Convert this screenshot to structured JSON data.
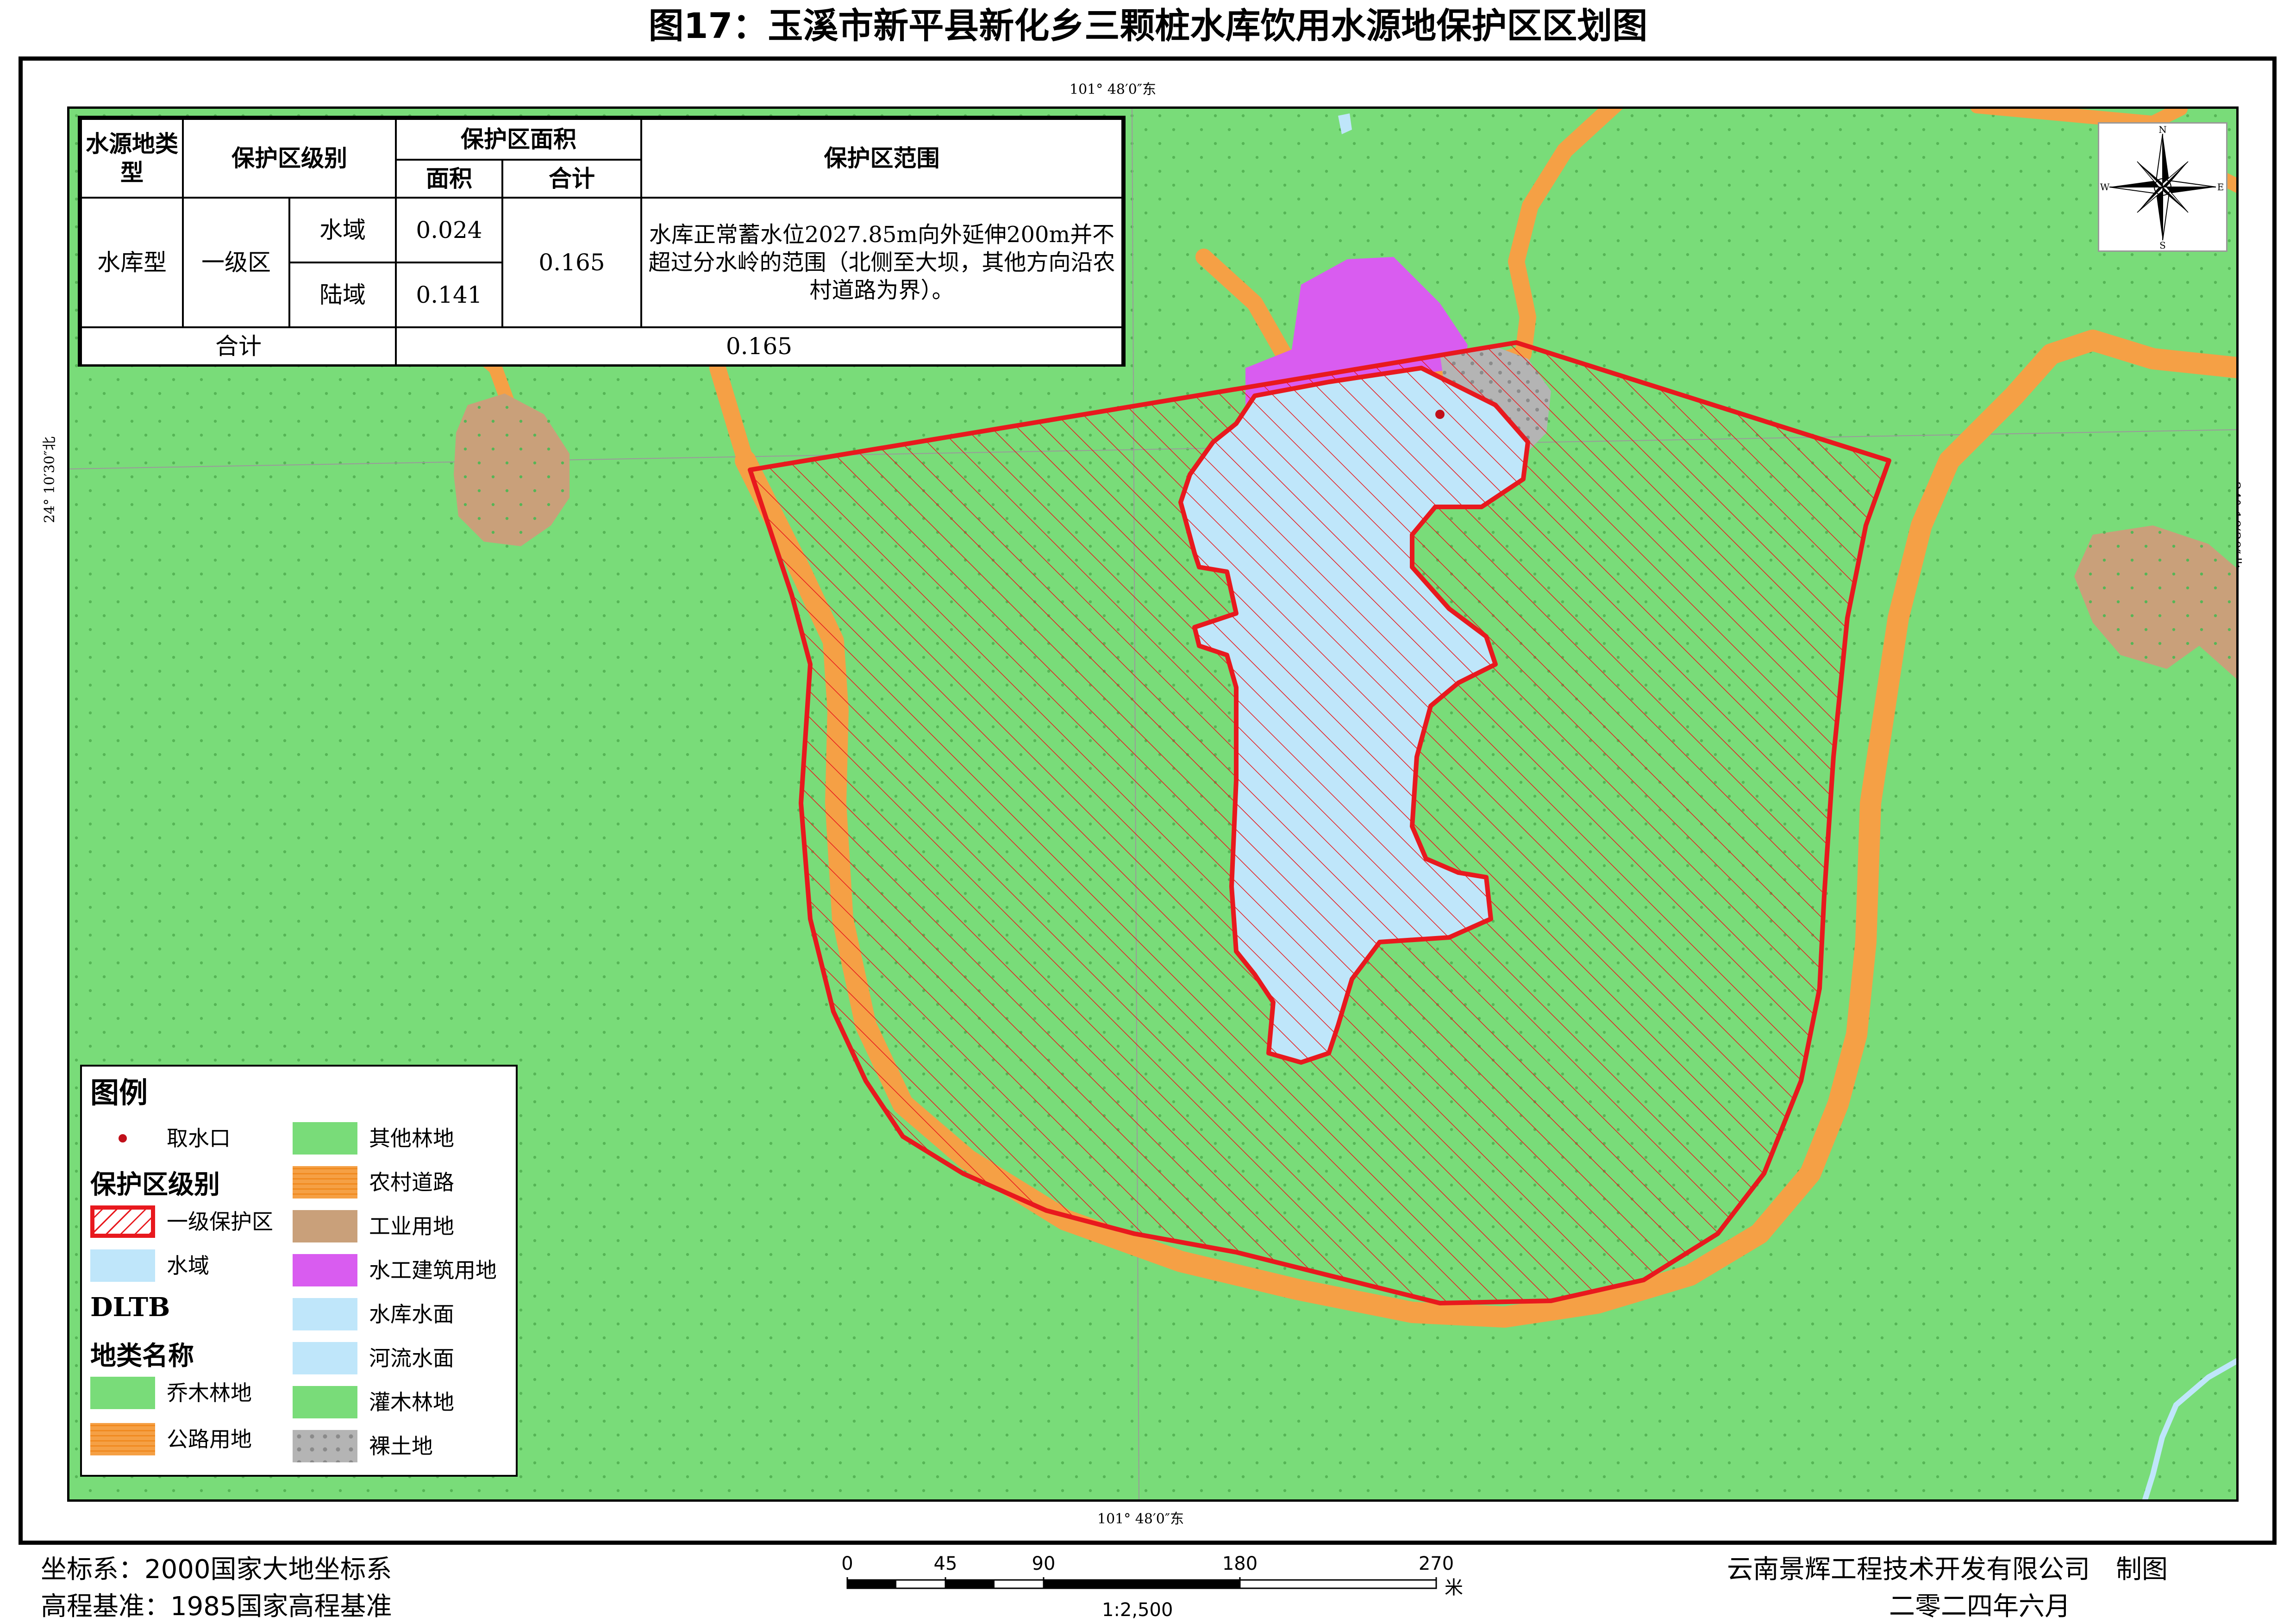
{
  "title": "图17：玉溪市新平县新化乡三颗桩水库饮用水源地保护区区划图",
  "coords": {
    "lon_top": "101° 48′0″东",
    "lon_bottom": "101° 48′0″东",
    "lat_left": "24° 10′30″北",
    "lat_right": "24° 10′30″北"
  },
  "table": {
    "h_source_type": "水源地类型",
    "h_level": "保护区级别",
    "h_area": "保护区面积",
    "h_area_sub": "面积",
    "h_total_sub": "合计",
    "h_scope": "保护区范围",
    "source_type": "水库型",
    "level": "一级区",
    "rows": [
      {
        "zone": "水域",
        "area": "0.024"
      },
      {
        "zone": "陆域",
        "area": "0.141"
      }
    ],
    "subtotal": "0.165",
    "scope": "水库正常蓄水位2027.85m向外延伸200m并不超过分水岭的范围（北侧至大坝，其他方向沿农村道路为界）。",
    "total_label": "合计",
    "total_value": "0.165"
  },
  "north_arrow": {
    "n": "N",
    "s": "S",
    "e": "E",
    "w": "W"
  },
  "legend": {
    "title": "图例",
    "intake": "取水口",
    "level_header": "保护区级别",
    "level1": "一级保护区",
    "water_area": "水域",
    "dltb": "DLTB",
    "landclass_header": "地类名称",
    "forest": "乔木林地",
    "road_hw": "公路用地",
    "other_forest": "其他林地",
    "rural_road": "农村道路",
    "industrial": "工业用地",
    "hydro_building": "水工建筑用地",
    "reservoir": "水库水面",
    "river": "河流水面",
    "shrub": "灌木林地",
    "bare": "裸土地"
  },
  "colors": {
    "forest": "#79dc79",
    "road": "#f5a045",
    "water": "#bfe6fa",
    "industrial": "#c9a07a",
    "hydro": "#d95cf0",
    "bare": "#b4b4b4",
    "protect": "#e8191e",
    "intake": "#c0101a"
  },
  "footer": {
    "crs": "坐标系：2000国家大地坐标系",
    "elev": "高程基准：1985国家高程基准",
    "company": "云南景辉工程技术开发有限公司　制图",
    "date": "二零二四年六月"
  },
  "scale": {
    "ticks": [
      "0",
      "45",
      "90",
      "180",
      "270"
    ],
    "unit": "米",
    "ratio": "1:2,500"
  }
}
